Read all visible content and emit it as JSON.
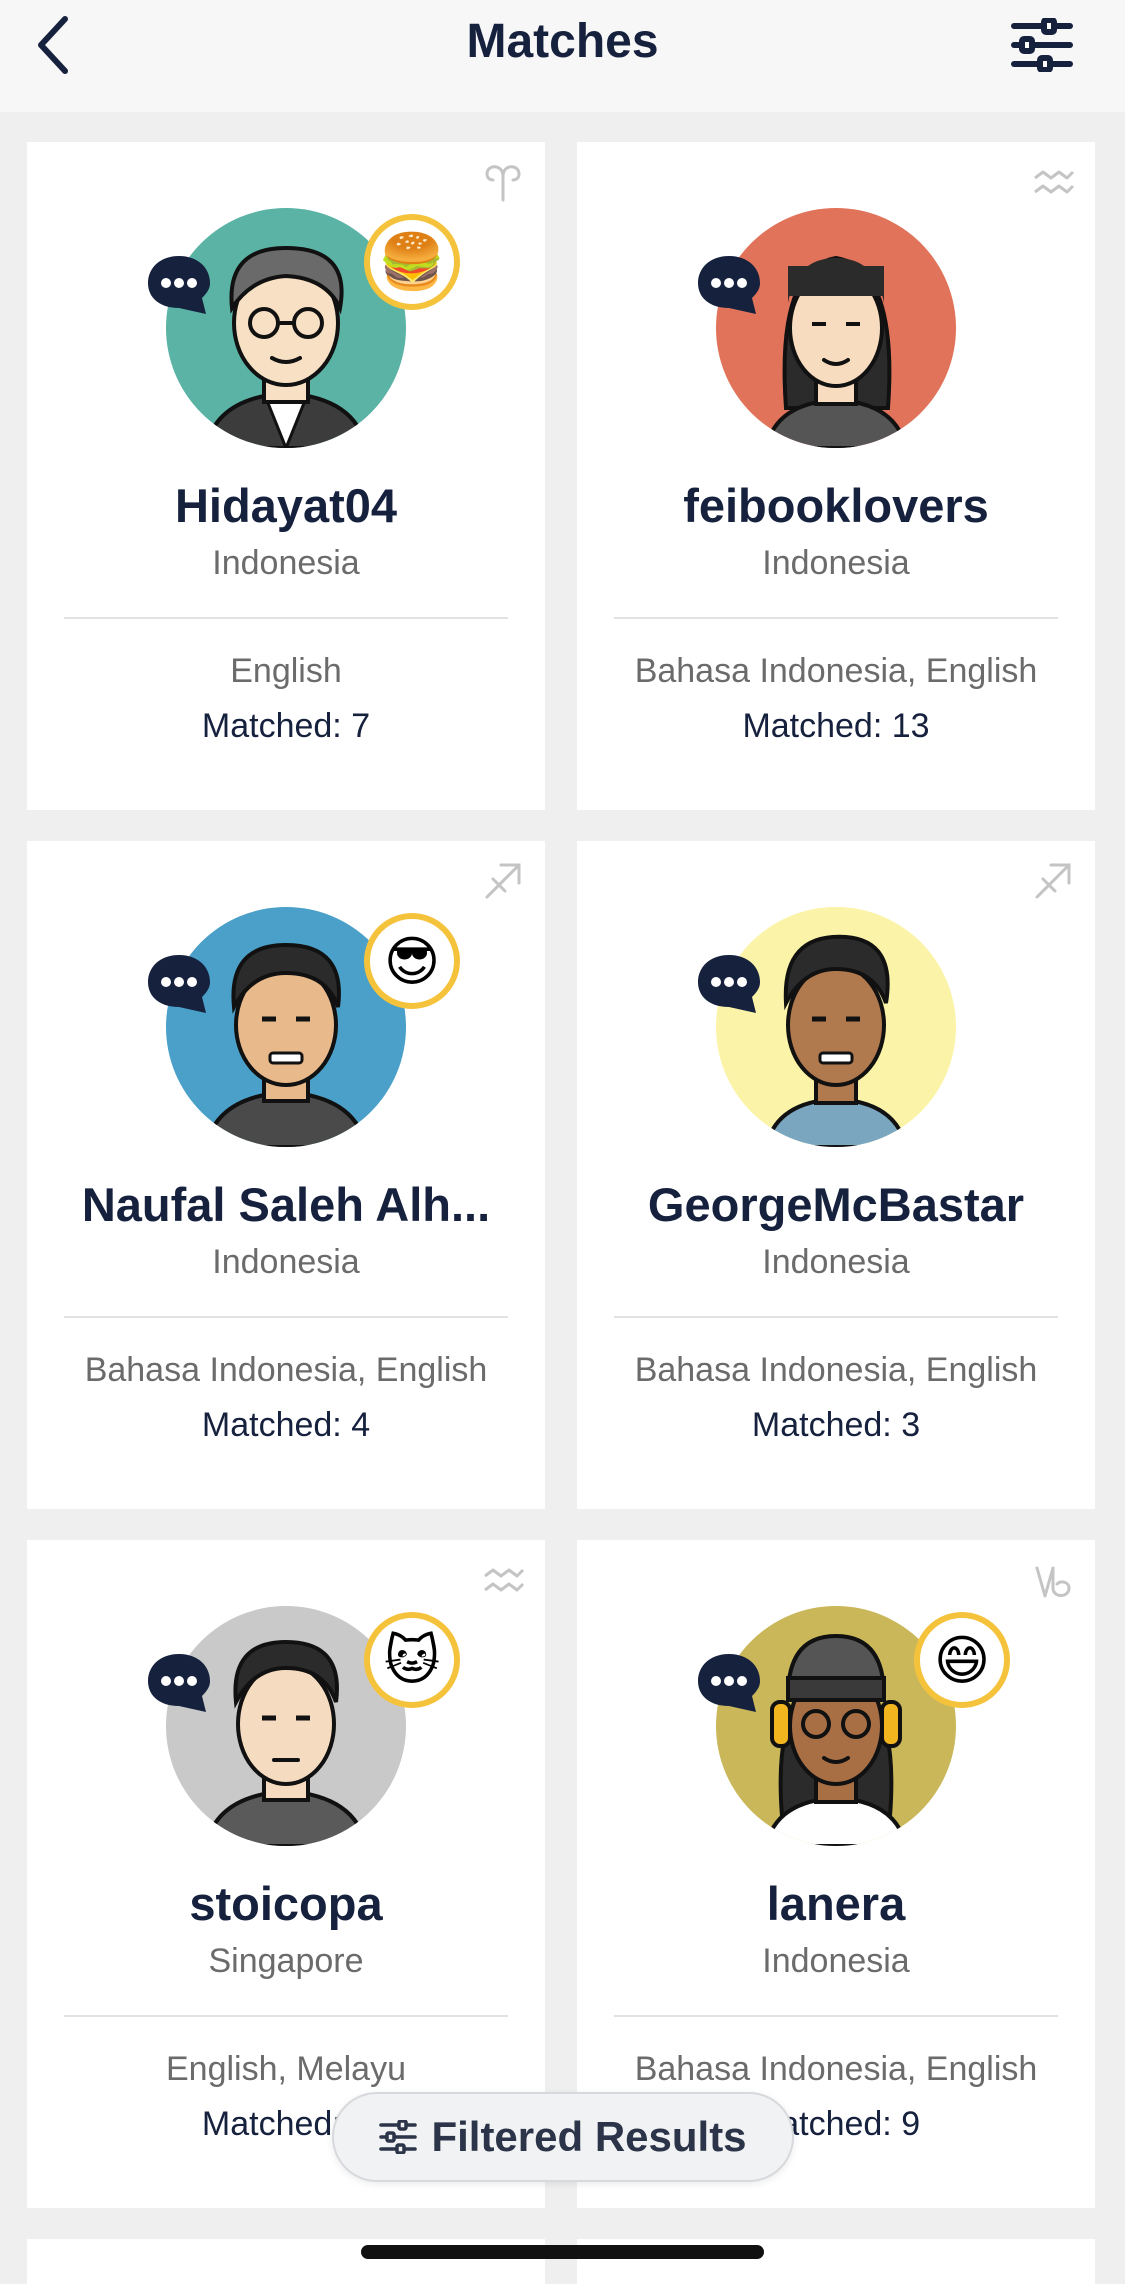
{
  "nav": {
    "title": "Matches",
    "back_icon": "chevron-left-icon",
    "filter_icon": "sliders-icon"
  },
  "matches": [
    {
      "name": "Hidayat04",
      "country": "Indonesia",
      "languages": "English",
      "matched": "Matched: 7",
      "badge_emoji": "🍔",
      "zodiac_icon": "aries-icon",
      "avatar_bg": "#5bb3a6"
    },
    {
      "name": "feibooklovers",
      "country": "Indonesia",
      "languages": "Bahasa Indonesia, English",
      "matched": "Matched: 13",
      "badge_emoji": "",
      "zodiac_icon": "aquarius-icon",
      "avatar_bg": "#e0735a"
    },
    {
      "name": "Naufal Saleh Alh...",
      "country": "Indonesia",
      "languages": "Bahasa Indonesia, English",
      "matched": "Matched: 4",
      "badge_emoji": "😎",
      "zodiac_icon": "sagittarius-icon",
      "avatar_bg": "#4aa0c8"
    },
    {
      "name": "GeorgeMcBastar",
      "country": "Indonesia",
      "languages": "Bahasa Indonesia, English",
      "matched": "Matched: 3",
      "badge_emoji": "",
      "zodiac_icon": "sagittarius-icon",
      "avatar_bg": "#fbf4a8"
    },
    {
      "name": "stoicopa",
      "country": "Singapore",
      "languages": "English, Melayu",
      "matched": "Matched: 5",
      "badge_emoji": "🐱",
      "zodiac_icon": "aquarius-icon",
      "avatar_bg": "#c9c9c9"
    },
    {
      "name": "lanera",
      "country": "Indonesia",
      "languages": "Bahasa Indonesia, English",
      "matched": "Matched: 9",
      "badge_emoji": "😄",
      "zodiac_icon": "capricorn-icon",
      "avatar_bg": "#c9b75a"
    }
  ],
  "filtered_results": {
    "label": "Filtered Results",
    "icon": "sliders-icon"
  },
  "colors": {
    "primary_text": "#16213e",
    "secondary_text": "#6b6b6b",
    "badge_ring": "#f5c33b",
    "chat_bubble": "#16213e"
  }
}
